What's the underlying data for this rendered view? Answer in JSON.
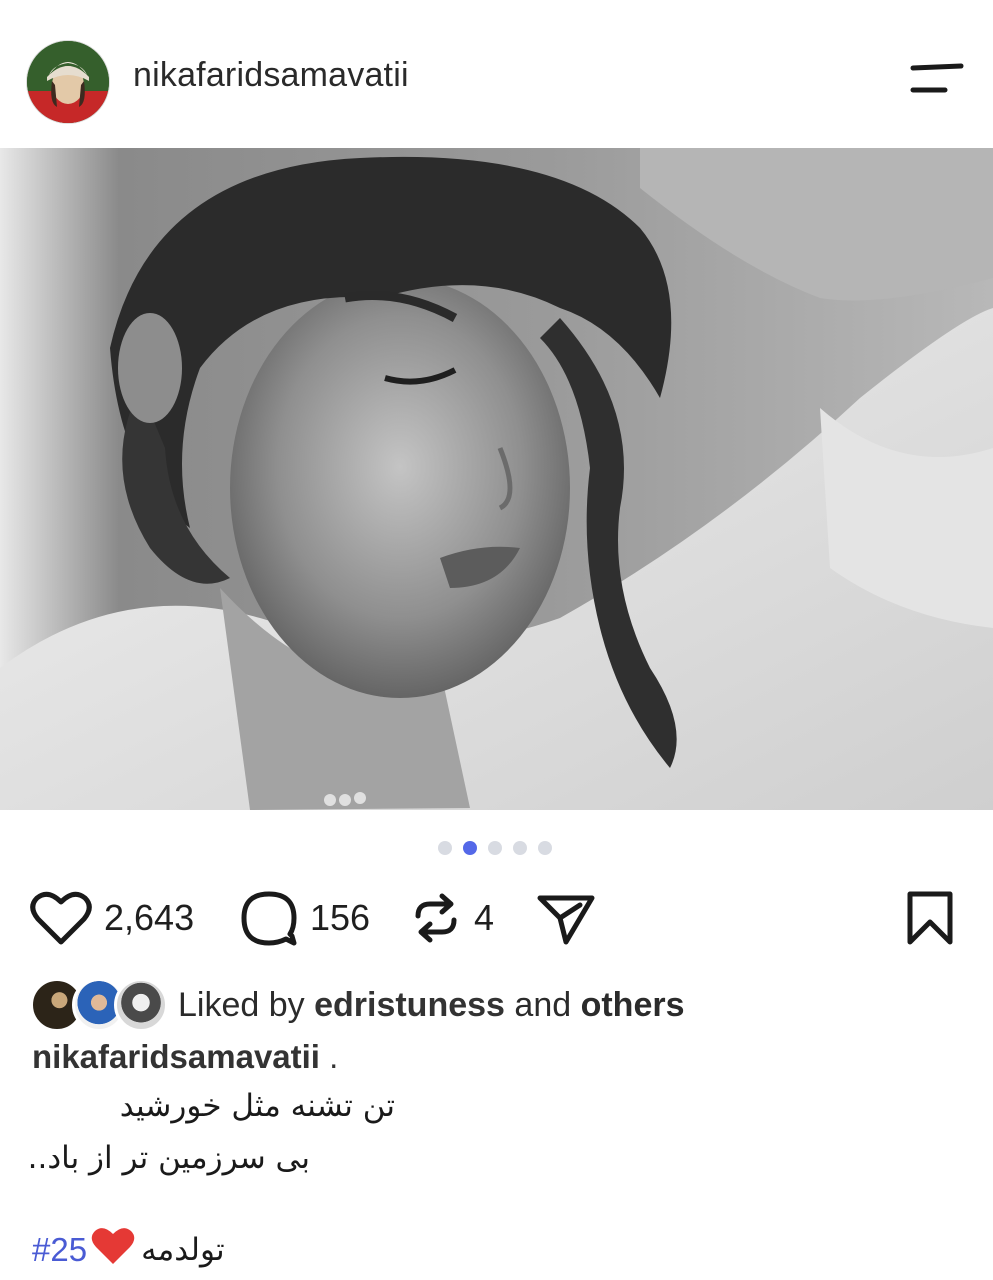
{
  "header": {
    "username": "nikafaridsamavatii"
  },
  "carousel": {
    "count": 5,
    "active_index": 1
  },
  "actions": {
    "likes": "2,643",
    "comments": "156",
    "reposts": "4"
  },
  "liked_by": {
    "prefix": "Liked by",
    "user": "edristuness",
    "conjunction": "and",
    "others": "others"
  },
  "caption": {
    "username": "nikafaridsamavatii",
    "suffix": " .",
    "line1": "تن تشنه مثل خورشید",
    "line2": "بی سرزمین تر از باد..",
    "hashtag": "#25",
    "hashtag_text": "تولدمه"
  },
  "colors": {
    "accent": "#4a5bd4",
    "heart": "#e53935",
    "dot_active": "#5468e8",
    "dot_inactive": "#d8dbe2"
  },
  "icons": {
    "menu": "menu-icon",
    "like": "heart-icon",
    "comment": "comment-icon",
    "repost": "repost-icon",
    "share": "send-icon",
    "save": "bookmark-icon"
  }
}
